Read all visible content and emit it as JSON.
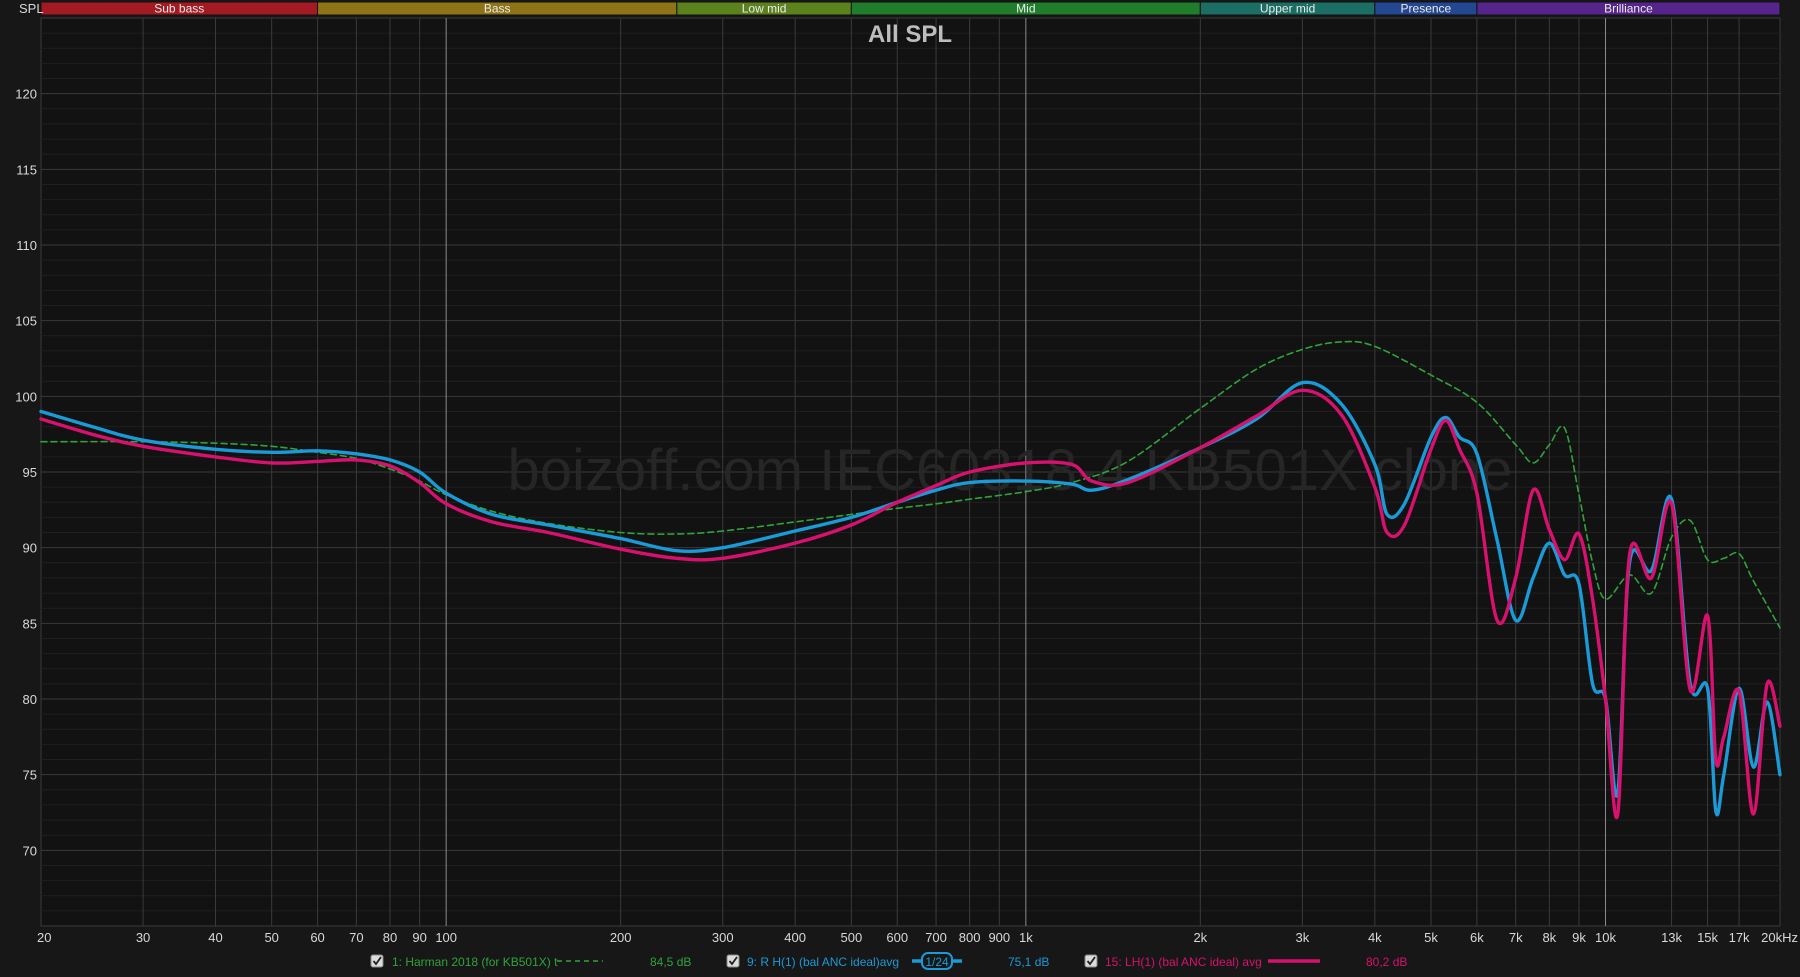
{
  "chart_data": {
    "type": "line",
    "title": "All SPL",
    "ylabel": "SPL",
    "xlabel": "",
    "x_scale": "log",
    "xlim": [
      20,
      20000
    ],
    "ylim": [
      65,
      125
    ],
    "grid": true,
    "watermark": "boizoff.com IEC60318-4 KB501X clone",
    "y_ticks": [
      {
        "value": 70,
        "label": "70"
      },
      {
        "value": 75,
        "label": "75"
      },
      {
        "value": 80,
        "label": "80"
      },
      {
        "value": 85,
        "label": "85"
      },
      {
        "value": 90,
        "label": "90"
      },
      {
        "value": 95,
        "label": "95"
      },
      {
        "value": 100,
        "label": "100"
      },
      {
        "value": 105,
        "label": "105"
      },
      {
        "value": 110,
        "label": "110"
      },
      {
        "value": 115,
        "label": "115"
      },
      {
        "value": 120,
        "label": "120"
      }
    ],
    "x_ticks": [
      {
        "value": 20,
        "label": "20",
        "major": false
      },
      {
        "value": 30,
        "label": "30",
        "major": false
      },
      {
        "value": 40,
        "label": "40",
        "major": false
      },
      {
        "value": 50,
        "label": "50",
        "major": false
      },
      {
        "value": 60,
        "label": "60",
        "major": false
      },
      {
        "value": 70,
        "label": "70",
        "major": false
      },
      {
        "value": 80,
        "label": "80",
        "major": false
      },
      {
        "value": 90,
        "label": "90",
        "major": false
      },
      {
        "value": 100,
        "label": "100",
        "major": true
      },
      {
        "value": 200,
        "label": "200",
        "major": false
      },
      {
        "value": 300,
        "label": "300",
        "major": false
      },
      {
        "value": 400,
        "label": "400",
        "major": false
      },
      {
        "value": 500,
        "label": "500",
        "major": false
      },
      {
        "value": 600,
        "label": "600",
        "major": false
      },
      {
        "value": 700,
        "label": "700",
        "major": false
      },
      {
        "value": 800,
        "label": "800",
        "major": false
      },
      {
        "value": 900,
        "label": "900",
        "major": false
      },
      {
        "value": 1000,
        "label": "1k",
        "major": true
      },
      {
        "value": 2000,
        "label": "2k",
        "major": false
      },
      {
        "value": 3000,
        "label": "3k",
        "major": false
      },
      {
        "value": 4000,
        "label": "4k",
        "major": false
      },
      {
        "value": 5000,
        "label": "5k",
        "major": false
      },
      {
        "value": 6000,
        "label": "6k",
        "major": false
      },
      {
        "value": 7000,
        "label": "7k",
        "major": false
      },
      {
        "value": 8000,
        "label": "8k",
        "major": false
      },
      {
        "value": 9000,
        "label": "9k",
        "major": false
      },
      {
        "value": 10000,
        "label": "10k",
        "major": true
      },
      {
        "value": 13000,
        "label": "13k",
        "major": false
      },
      {
        "value": 15000,
        "label": "15k",
        "major": false
      },
      {
        "value": 17000,
        "label": "17k",
        "major": false
      },
      {
        "value": 20000,
        "label": "20kHz",
        "major": false
      }
    ],
    "bands": [
      {
        "name": "Sub bass",
        "from": 20,
        "to": 60,
        "color": "#a31a23"
      },
      {
        "name": "Bass",
        "from": 60,
        "to": 250,
        "color": "#8e7416"
      },
      {
        "name": "Low mid",
        "from": 250,
        "to": 500,
        "color": "#5b821d"
      },
      {
        "name": "Mid",
        "from": 500,
        "to": 2000,
        "color": "#1f7d2c"
      },
      {
        "name": "Upper mid",
        "from": 2000,
        "to": 4000,
        "color": "#1b6e64"
      },
      {
        "name": "Presence",
        "from": 4000,
        "to": 6000,
        "color": "#234791"
      },
      {
        "name": "Brilliance",
        "from": 6000,
        "to": 20000,
        "color": "#55258c"
      }
    ],
    "series": [
      {
        "name": "1: Harman 2018 (for KB501X) t",
        "legend_value": "84,5 dB",
        "color": "#2fa33a",
        "style": "dashed",
        "x": [
          20,
          30,
          40,
          50,
          60,
          70,
          80,
          90,
          100,
          120,
          150,
          200,
          250,
          300,
          400,
          500,
          600,
          700,
          800,
          1000,
          1200,
          1500,
          2000,
          2500,
          3000,
          3500,
          4000,
          5000,
          6000,
          7000,
          7500,
          8000,
          8500,
          9000,
          9500,
          10000,
          11000,
          12000,
          13000,
          14000,
          15000,
          16000,
          17000,
          18000,
          20000
        ],
        "y": [
          97.0,
          97.0,
          96.9,
          96.7,
          96.3,
          95.9,
          95.2,
          94.4,
          93.5,
          92.4,
          91.6,
          91.0,
          90.9,
          91.1,
          91.7,
          92.2,
          92.6,
          92.9,
          93.2,
          93.7,
          94.3,
          95.7,
          99.2,
          101.8,
          103.1,
          103.6,
          103.3,
          101.4,
          99.6,
          96.8,
          95.6,
          96.8,
          97.9,
          93.5,
          89.0,
          86.6,
          88.2,
          87.0,
          90.7,
          91.8,
          89.2,
          89.3,
          89.6,
          87.8,
          84.7
        ]
      },
      {
        "name": "9: R H(1) (bal ANC ideal)avg",
        "legend_value": "75,1 dB",
        "smoothing": "1/24",
        "color": "#1a9ad6",
        "style": "solid",
        "x": [
          20,
          25,
          30,
          40,
          50,
          60,
          70,
          80,
          90,
          100,
          120,
          150,
          200,
          250,
          300,
          400,
          500,
          600,
          700,
          800,
          1000,
          1200,
          1300,
          1500,
          2000,
          2500,
          3000,
          3500,
          4000,
          4200,
          4500,
          5000,
          5300,
          5600,
          6000,
          6500,
          7000,
          7500,
          8000,
          8500,
          9000,
          9500,
          10000,
          10500,
          11000,
          12000,
          13000,
          14000,
          15000,
          15500,
          16000,
          17000,
          18000,
          19000,
          20000
        ],
        "y": [
          99.0,
          97.9,
          97.1,
          96.5,
          96.3,
          96.4,
          96.2,
          95.8,
          95.0,
          93.6,
          92.2,
          91.5,
          90.6,
          89.8,
          90.0,
          91.1,
          92.0,
          93.0,
          93.8,
          94.3,
          94.4,
          94.2,
          93.8,
          94.5,
          96.6,
          98.5,
          100.9,
          99.5,
          95.5,
          92.2,
          92.9,
          97.3,
          98.6,
          97.3,
          96.2,
          90.5,
          85.2,
          88.0,
          90.3,
          88.2,
          87.6,
          81.0,
          80.0,
          73.8,
          89.0,
          88.5,
          93.2,
          81.0,
          80.7,
          72.6,
          75.0,
          80.7,
          75.5,
          79.8,
          75.0
        ]
      },
      {
        "name": "15: LH(1) (bal ANC ideal) avg",
        "legend_value": "80,2 dB",
        "color": "#d8106e",
        "style": "solid",
        "x": [
          20,
          25,
          30,
          40,
          50,
          60,
          70,
          80,
          90,
          100,
          120,
          150,
          200,
          250,
          300,
          400,
          500,
          600,
          700,
          800,
          1000,
          1200,
          1300,
          1500,
          2000,
          2500,
          3000,
          3500,
          4000,
          4200,
          4500,
          5000,
          5300,
          5600,
          6000,
          6500,
          7000,
          7500,
          8000,
          8500,
          9000,
          9500,
          10000,
          10500,
          11000,
          12000,
          13000,
          14000,
          15000,
          15500,
          16000,
          17000,
          18000,
          19000,
          20000
        ],
        "y": [
          98.5,
          97.4,
          96.7,
          96.0,
          95.6,
          95.7,
          95.8,
          95.4,
          94.3,
          92.9,
          91.7,
          91.0,
          89.9,
          89.3,
          89.3,
          90.3,
          91.5,
          93.0,
          94.1,
          95.0,
          95.6,
          95.5,
          94.4,
          94.3,
          96.6,
          98.7,
          100.4,
          98.8,
          94.0,
          91.0,
          91.5,
          96.5,
          98.4,
          96.5,
          93.6,
          85.2,
          88.0,
          93.8,
          91.2,
          89.2,
          90.9,
          86.6,
          80.0,
          72.4,
          89.5,
          88.0,
          92.9,
          80.6,
          85.5,
          76.0,
          77.5,
          80.5,
          72.4,
          81.0,
          78.2
        ]
      }
    ]
  }
}
